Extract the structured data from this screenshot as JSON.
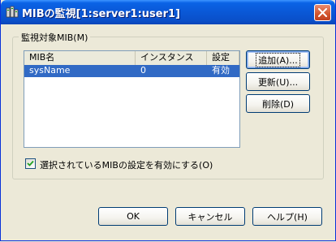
{
  "window": {
    "title": "MIBの監視[1:server1:user1]"
  },
  "group": {
    "label": "監視対象MIB(M)"
  },
  "listview": {
    "columns": [
      "MIB名",
      "インスタンス",
      "設定"
    ],
    "rows": [
      {
        "mib": "sysName",
        "instance": "0",
        "setting": "有効"
      }
    ]
  },
  "side_buttons": {
    "add": "追加(A)...",
    "update": "更新(U)...",
    "delete": "削除(D)"
  },
  "checkbox": {
    "label": "選択されているMIBの設定を有効にする(O)",
    "checked": true
  },
  "footer_buttons": {
    "ok": "OK",
    "cancel": "キャンセル",
    "help": "ヘルプ(H)"
  },
  "colors": {
    "titlebar": "#0a58d6",
    "selection": "#316ac5",
    "face": "#ece9d8"
  },
  "icons": {
    "window": "app-icon",
    "close": "close-icon",
    "check": "check-icon"
  }
}
